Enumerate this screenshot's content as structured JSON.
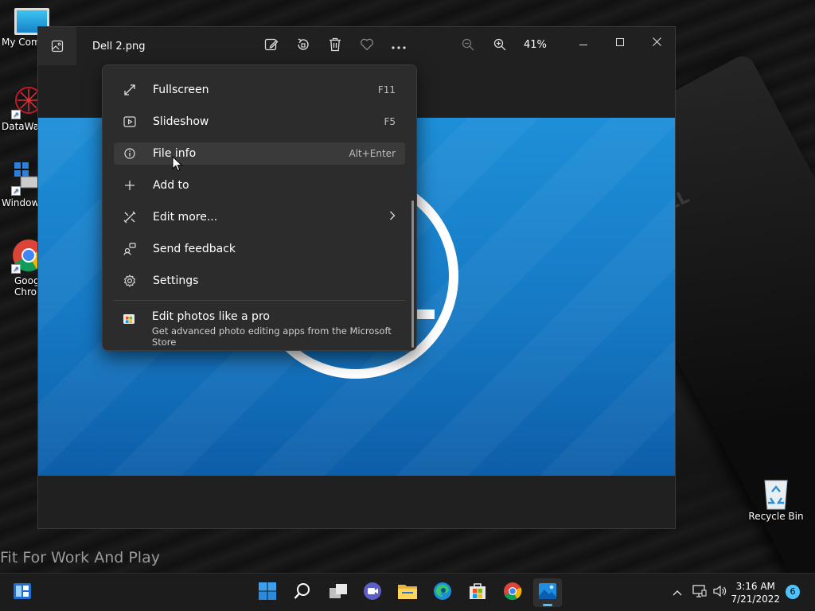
{
  "desktop": {
    "icons": [
      {
        "label": "My Com",
        "name": "my-computer"
      },
      {
        "label": "DataWag",
        "name": "datawag"
      },
      {
        "label": "Window",
        "name": "windows"
      },
      {
        "label": "Goog Chron",
        "name": "google-chrome"
      }
    ],
    "recycle_bin_label": "Recycle Bin",
    "wallpaper_slogan": "Fit For Work And Play",
    "laptop_logo": "LL"
  },
  "window": {
    "file_name": "Dell 2.png",
    "zoom_level": "41%",
    "toolbar_icons": [
      "edit-image-icon",
      "rotate-icon",
      "delete-icon",
      "favorite-icon",
      "more-icon",
      "zoom-out-icon",
      "zoom-in-icon"
    ],
    "controls": [
      "minimize-icon",
      "maximize-icon",
      "close-icon"
    ]
  },
  "more_menu": {
    "items": [
      {
        "label": "Fullscreen",
        "shortcut": "F11",
        "icon": "fullscreen-icon"
      },
      {
        "label": "Slideshow",
        "shortcut": "F5",
        "icon": "slideshow-icon"
      },
      {
        "label": "File info",
        "shortcut": "Alt+Enter",
        "icon": "info-icon",
        "hovered": true
      },
      {
        "label": "Add to",
        "shortcut": "",
        "icon": "plus-icon"
      },
      {
        "label": "Edit more...",
        "shortcut": "",
        "icon": "edit-more-icon",
        "submenu": true
      },
      {
        "label": "Send feedback",
        "shortcut": "",
        "icon": "feedback-icon"
      },
      {
        "label": "Settings",
        "shortcut": "",
        "icon": "settings-icon"
      }
    ],
    "promo": {
      "title": "Edit photos like a pro",
      "subtitle": "Get advanced photo editing apps from the Microsoft Store",
      "icon": "store-icon"
    }
  },
  "taskbar": {
    "apps": [
      "widgets",
      "start",
      "search",
      "task-view",
      "chat",
      "file-explorer",
      "edge",
      "store",
      "chrome",
      "photos"
    ],
    "active_app": "photos",
    "time": "3:16 AM",
    "date": "7/21/2022",
    "notification_count": "6"
  },
  "colors": {
    "accent": "#4cc2ff",
    "menu_bg": "#2c2c2c",
    "dell_blue": "#1679c4"
  }
}
